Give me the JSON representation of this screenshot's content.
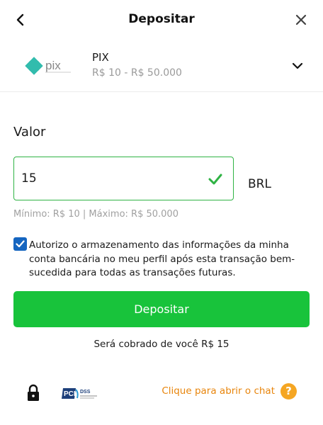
{
  "header": {
    "title": "Depositar",
    "back_icon": "chevron-left-icon",
    "close_icon": "close-icon"
  },
  "payment_method": {
    "logo_text": "pix",
    "name": "PIX",
    "range": "R$ 10 - R$ 50.000",
    "dropdown_icon": "chevron-down-icon"
  },
  "amount": {
    "label": "Valor",
    "value": "15",
    "currency": "BRL",
    "limits": "Mínimo: R$ 10 | Máximo: R$ 50.000",
    "valid_color": "#2fb344"
  },
  "consent": {
    "checked": true,
    "text": "Autorizo o armazenamento das informações da minha conta bancária no meu perfil após esta transação bem-sucedida para todas as transações futuras."
  },
  "submit": {
    "label": "Depositar",
    "color": "#18c33b"
  },
  "charge_note": "Será cobrado de você R$ 15",
  "footer": {
    "lock_icon": "lock-icon",
    "pci_logo_text": "PCI DSS",
    "chat_label": "Clique para abrir o chat",
    "help_icon_glyph": "?",
    "chat_color": "#e8850c"
  }
}
